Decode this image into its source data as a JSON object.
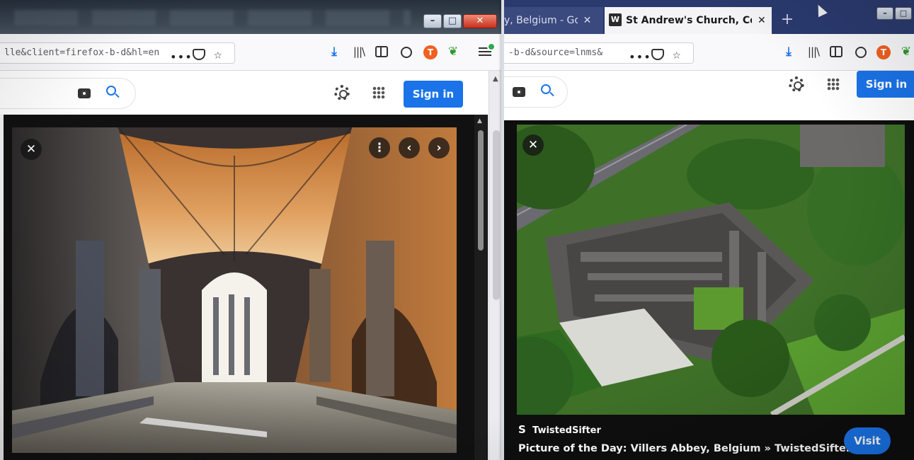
{
  "left_window": {
    "controls": {
      "minimize": "–",
      "maximize": "□",
      "close": "✕"
    },
    "url_text": "lle&client=firefox-b-d&hl=en",
    "url_actions": {
      "more": "•••"
    },
    "toolbar_icons": [
      "download-icon",
      "library-icon",
      "sidebar-icon",
      "account-icon",
      "extension-t-icon",
      "extension-green-icon",
      "menu-icon"
    ],
    "google_bar": {
      "sign_in": "Sign in"
    },
    "viewer": {
      "close_label": "✕",
      "more_label": "⋮",
      "prev_label": "‹",
      "next_label": "›"
    }
  },
  "right_window": {
    "tabs": [
      {
        "label": "y, Belgium - Googl",
        "close": "✕"
      },
      {
        "favicon": "W",
        "label": "St Andrew's Church, Covehithe",
        "close": "✕"
      }
    ],
    "new_tab": "+",
    "url_text": "-b-d&source=lnms&",
    "url_actions": {
      "more": "•••"
    },
    "google_bar": {
      "sign_in": "Sign in"
    },
    "viewer": {
      "close_label": "✕",
      "source": "TwistedSifter",
      "source_icon": "S",
      "caption": "Picture of the Day: Villers Abbey, Belgium » TwistedSifter",
      "visit": "Visit"
    }
  },
  "colors": {
    "google_blue": "#1a73e8",
    "tab_bar": "#2a3a6e"
  }
}
